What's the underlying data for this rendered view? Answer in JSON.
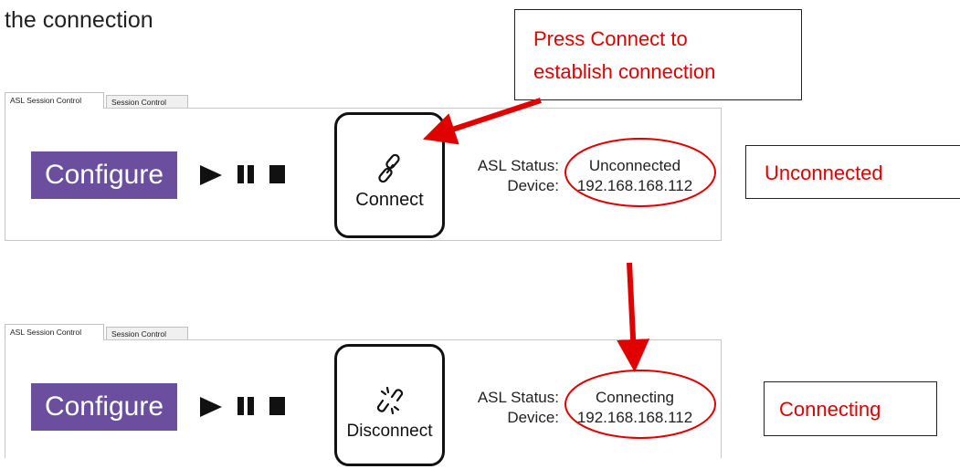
{
  "heading": "the connection",
  "callouts": {
    "press_line1": "Press Connect to",
    "press_line2": "establish connection",
    "unconnected": "Unconnected",
    "connecting": "Connecting"
  },
  "colors": {
    "annotation_red": "#e00000",
    "configure_bg": "#6b4f9e"
  },
  "panel_top": {
    "tabs": [
      "ASL Session Control",
      "Session Control"
    ],
    "configure_label": "Configure",
    "button_label": "Connect",
    "button_icon": "link-icon",
    "status_label": "ASL Status:",
    "device_label": "Device:",
    "status_value": "Unconnected",
    "device_value": "192.168.168.112"
  },
  "panel_bottom": {
    "tabs": [
      "ASL Session Control",
      "Session Control"
    ],
    "configure_label": "Configure",
    "button_label": "Disconnect",
    "button_icon": "broken-link-icon",
    "status_label": "ASL Status:",
    "device_label": "Device:",
    "status_value": "Connecting",
    "device_value": "192.168.168.112"
  }
}
